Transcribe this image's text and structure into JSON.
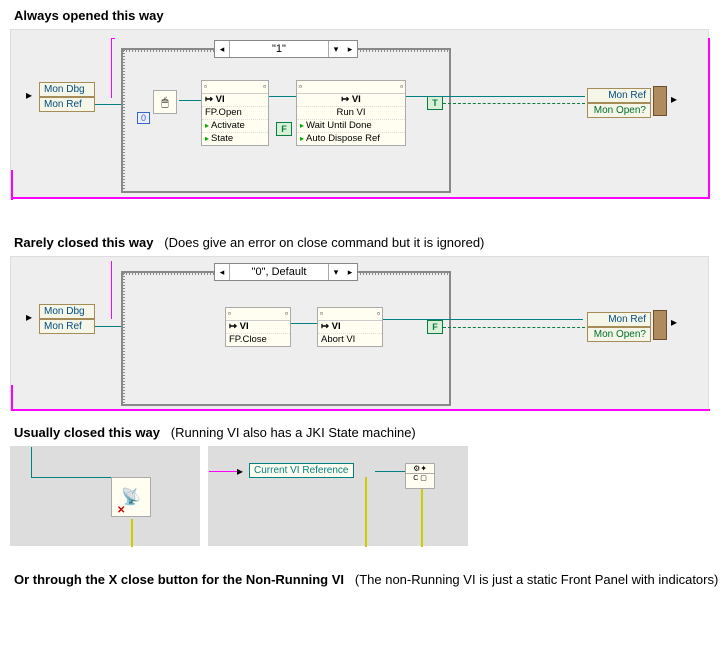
{
  "section1": {
    "title": "Always opened this way",
    "caseLabel": "\"1\"",
    "unbundle": {
      "a": "Mon Dbg",
      "b": "Mon Ref"
    },
    "bundle": {
      "a": "Mon Ref",
      "b": "Mon Open?"
    },
    "constZero": "0",
    "node1": {
      "title": "VI",
      "rows": [
        "FP.Open",
        "Activate",
        "State"
      ]
    },
    "node2": {
      "title": "VI",
      "rows": [
        "Run VI",
        "Wait Until Done",
        "Auto Dispose Ref"
      ]
    },
    "boolF": "F",
    "boolT": "T"
  },
  "section2": {
    "title": "Rarely closed this way",
    "subtitle": "(Does give an error on close command but it is ignored)",
    "caseLabel": "\"0\", Default",
    "unbundle": {
      "a": "Mon Dbg",
      "b": "Mon Ref"
    },
    "bundle": {
      "a": "Mon Ref",
      "b": "Mon Open?"
    },
    "node1": {
      "title": "VI",
      "rows": [
        "FP.Close"
      ]
    },
    "node2": {
      "title": "VI",
      "rows": [
        "Abort VI"
      ]
    },
    "boolF": "F"
  },
  "section3": {
    "title": "Usually closed this way",
    "subtitle": "(Running VI also has a JKI State machine)",
    "refLabel": "Current VI Reference"
  },
  "section4": {
    "title": "Or through the X close button for the Non-Running VI",
    "subtitle": "(The non-Running VI is just a static Front Panel with indicators)"
  }
}
